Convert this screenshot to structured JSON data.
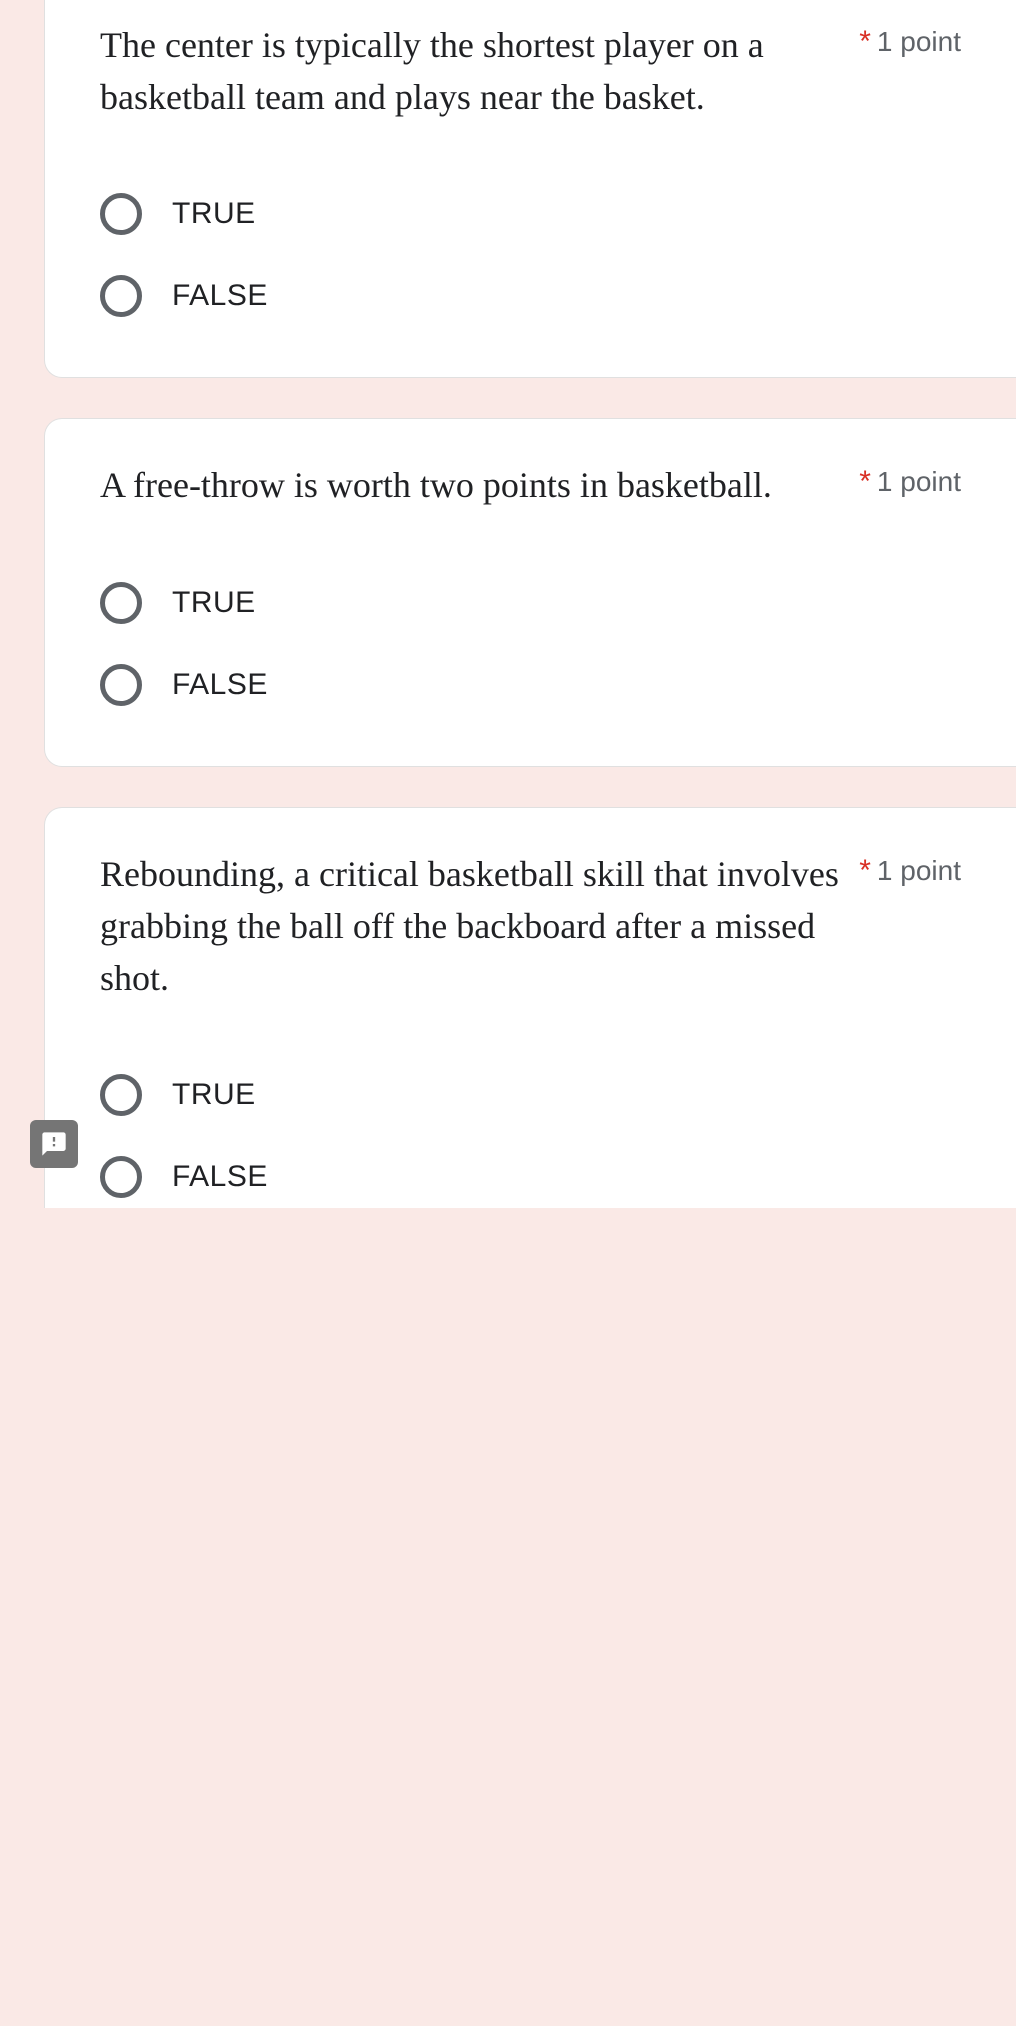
{
  "points_label": "1 point",
  "option_true": "TRUE",
  "option_false": "FALSE",
  "questions": [
    {
      "text": "The center is typically the shortest player on a basketball team and plays near the basket."
    },
    {
      "text": "A free-throw is worth two points in basketball."
    },
    {
      "text": "Rebounding, a critical basketball skill that involves grabbing the ball off the backboard after a missed shot."
    }
  ]
}
